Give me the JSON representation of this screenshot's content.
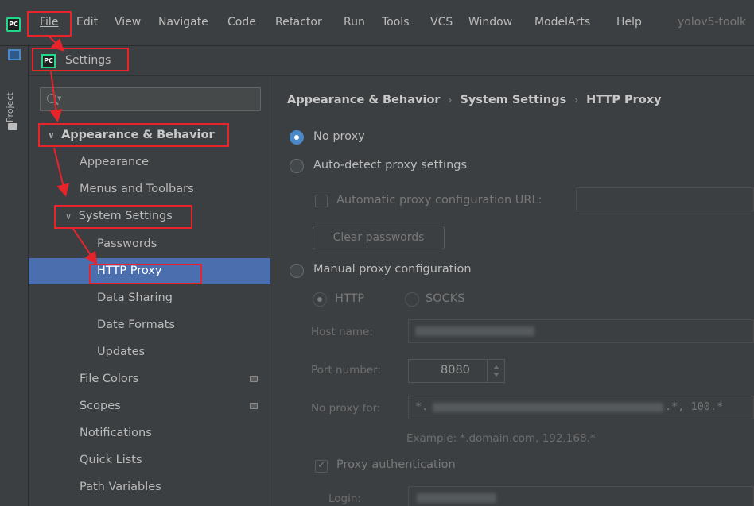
{
  "menubar": {
    "items": [
      "File",
      "Edit",
      "View",
      "Navigate",
      "Code",
      "Refactor",
      "Run",
      "Tools",
      "VCS",
      "Window",
      "ModelArts",
      "Help"
    ],
    "window_title": "yolov5-toolk"
  },
  "toolstrip": {
    "project_label": "Project"
  },
  "dialog": {
    "title": "Settings"
  },
  "sidebar": {
    "appearance_behavior": "Appearance & Behavior",
    "appearance": "Appearance",
    "menus_toolbars": "Menus and Toolbars",
    "system_settings": "System Settings",
    "passwords": "Passwords",
    "http_proxy": "HTTP Proxy",
    "data_sharing": "Data Sharing",
    "date_formats": "Date Formats",
    "updates": "Updates",
    "file_colors": "File Colors",
    "scopes": "Scopes",
    "notifications": "Notifications",
    "quick_lists": "Quick Lists",
    "path_variables": "Path Variables"
  },
  "content": {
    "breadcrumb": [
      "Appearance & Behavior",
      "System Settings",
      "HTTP Proxy"
    ],
    "no_proxy": "No proxy",
    "auto_detect": "Auto-detect proxy settings",
    "auto_config_url": "Automatic proxy configuration URL:",
    "clear_passwords": "Clear passwords",
    "manual": "Manual proxy configuration",
    "http": "HTTP",
    "socks": "SOCKS",
    "host_name": "Host name:",
    "port_number": "Port number:",
    "port_value": "8080",
    "no_proxy_for": "No proxy for:",
    "no_proxy_prefix": "*.",
    "no_proxy_suffix": ".*, 100.*",
    "example": "Example: *.domain.com, 192.168.*",
    "proxy_auth": "Proxy authentication",
    "login": "Login:"
  },
  "colors": {
    "accent": "#4b6eaf",
    "annotation": "#e8242b"
  }
}
